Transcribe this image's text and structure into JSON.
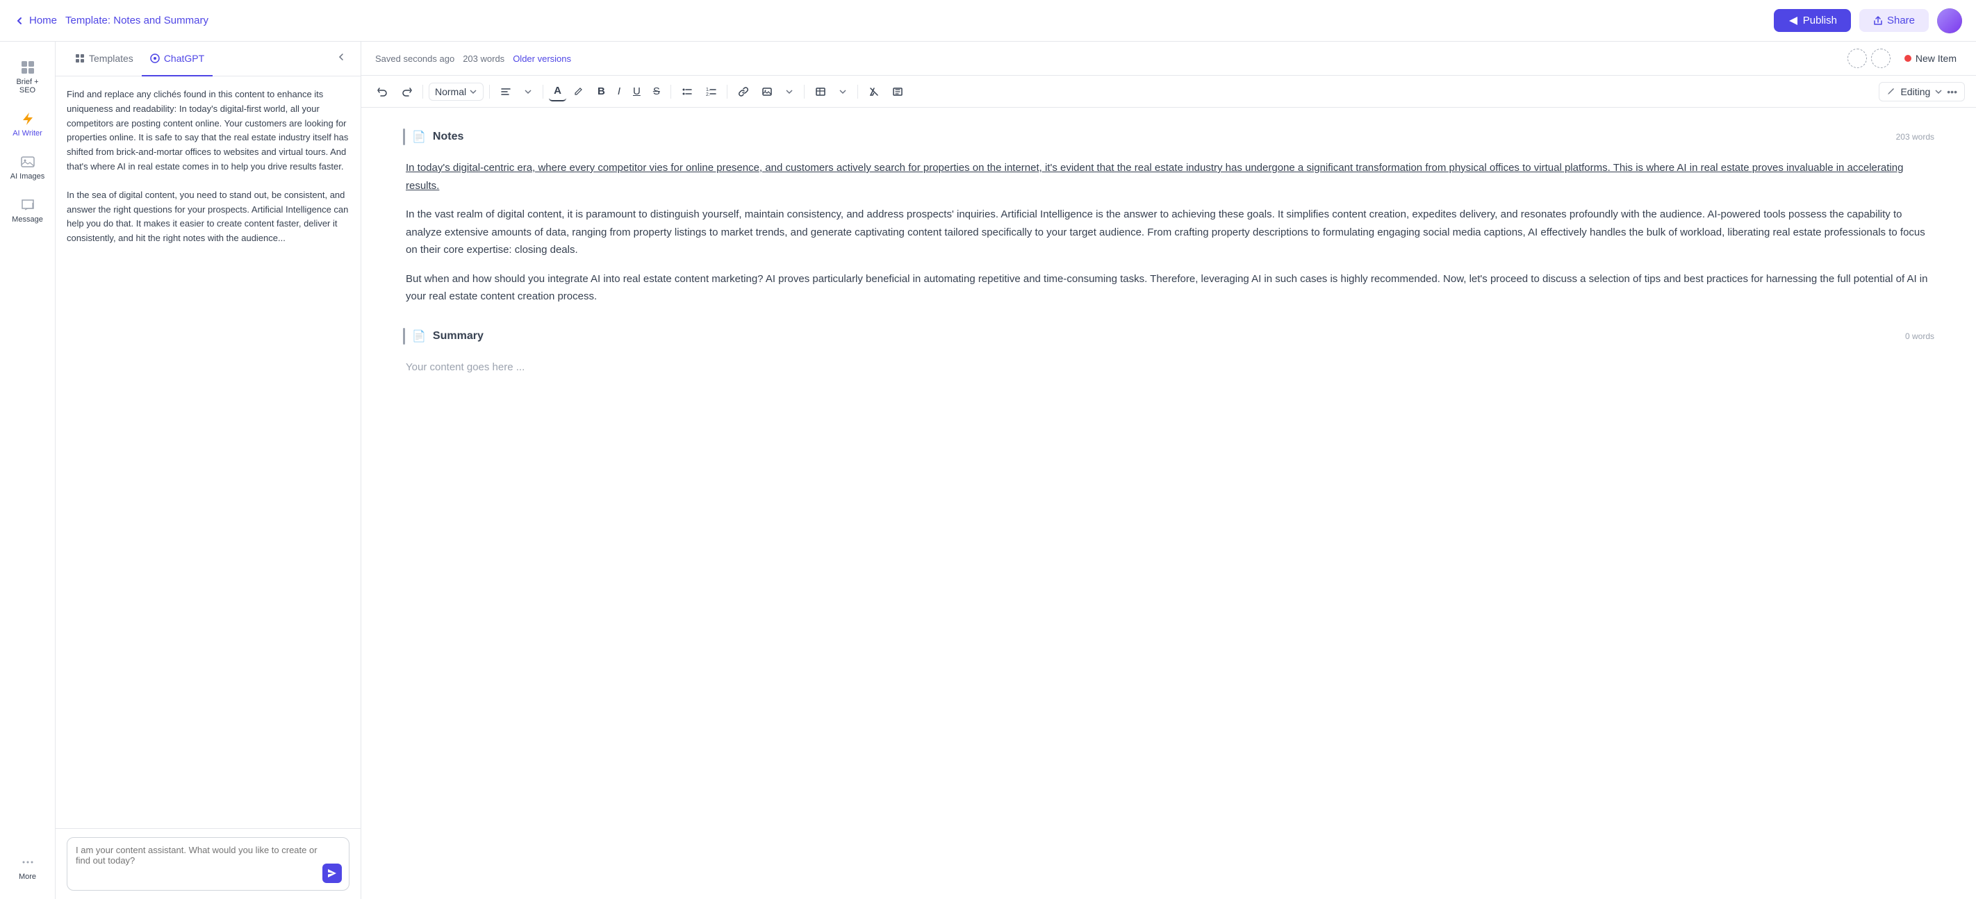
{
  "topNav": {
    "homeLabel": "Home",
    "breadcrumb": "Template:",
    "templateName": "Notes and Summary",
    "publishLabel": "Publish",
    "shareLabel": "Share"
  },
  "iconSidebar": {
    "items": [
      {
        "id": "brief-seo",
        "label": "Brief + SEO",
        "icon": "grid"
      },
      {
        "id": "ai-writer",
        "label": "AI Writer",
        "icon": "bolt",
        "active": true
      },
      {
        "id": "ai-images",
        "label": "AI Images",
        "icon": "image"
      },
      {
        "id": "message",
        "label": "Message",
        "icon": "chat"
      },
      {
        "id": "more",
        "label": "More",
        "icon": "dots"
      }
    ]
  },
  "panel": {
    "tabs": [
      {
        "id": "templates",
        "label": "Templates",
        "icon": "grid"
      },
      {
        "id": "chatgpt",
        "label": "ChatGPT",
        "icon": "chat",
        "active": true
      }
    ],
    "chatMessages": [
      {
        "id": 1,
        "text": "Find and replace any clichés found in this content to enhance its uniqueness and readability:\nIn today's digital-first world, all your competitors are posting content online. Your customers are looking for properties online. It is safe to say that the real estate industry itself has shifted from brick-and-mortar offices to websites and virtual tours. And that's where AI in real estate comes in to help you drive results faster."
      },
      {
        "id": 2,
        "text": "In the sea of digital content, you need to stand out, be consistent, and answer the right questions for your prospects. Artificial Intelligence can help you do that. It makes it easier to create content faster, deliver it consistently, and hit the right notes with the audience..."
      }
    ],
    "inputPlaceholder": "I am your content assistant. What would you like to create or find out today?"
  },
  "editorTopbar": {
    "savedText": "Saved seconds ago",
    "wordCount": "203 words",
    "olderVersions": "Older versions",
    "newItemLabel": "New Item"
  },
  "toolbar": {
    "styleLabel": "Normal",
    "editingLabel": "Editing"
  },
  "editor": {
    "sections": [
      {
        "id": "notes",
        "title": "Notes",
        "wordCount": "203 words",
        "paragraphs": [
          "In today's digital-centric era, where every competitor vies for online presence, and customers actively search for properties on the internet, it's evident that the real estate industry has undergone a significant transformation from physical offices to virtual platforms. This is where AI in real estate proves invaluable in accelerating results.",
          "In the vast realm of digital content, it is paramount to distinguish yourself, maintain consistency, and address prospects' inquiries. Artificial Intelligence is the answer to achieving these goals. It simplifies content creation, expedites delivery, and resonates profoundly with the audience. AI-powered tools possess the capability to analyze extensive amounts of data, ranging from property listings to market trends, and generate captivating content tailored specifically to your target audience. From crafting property descriptions to formulating engaging social media captions, AI effectively handles the bulk of workload, liberating real estate professionals to focus on their core expertise: closing deals.",
          "But when and how should you integrate AI into real estate content marketing? AI proves particularly beneficial in automating repetitive and time-consuming tasks. Therefore, leveraging AI in such cases is highly recommended. Now, let's proceed to discuss a selection of tips and best practices for harnessing the full potential of AI in your real estate content creation process."
        ],
        "hasUnderline": true
      },
      {
        "id": "summary",
        "title": "Summary",
        "wordCount": "0 words",
        "placeholder": "Your content goes here ..."
      }
    ]
  }
}
